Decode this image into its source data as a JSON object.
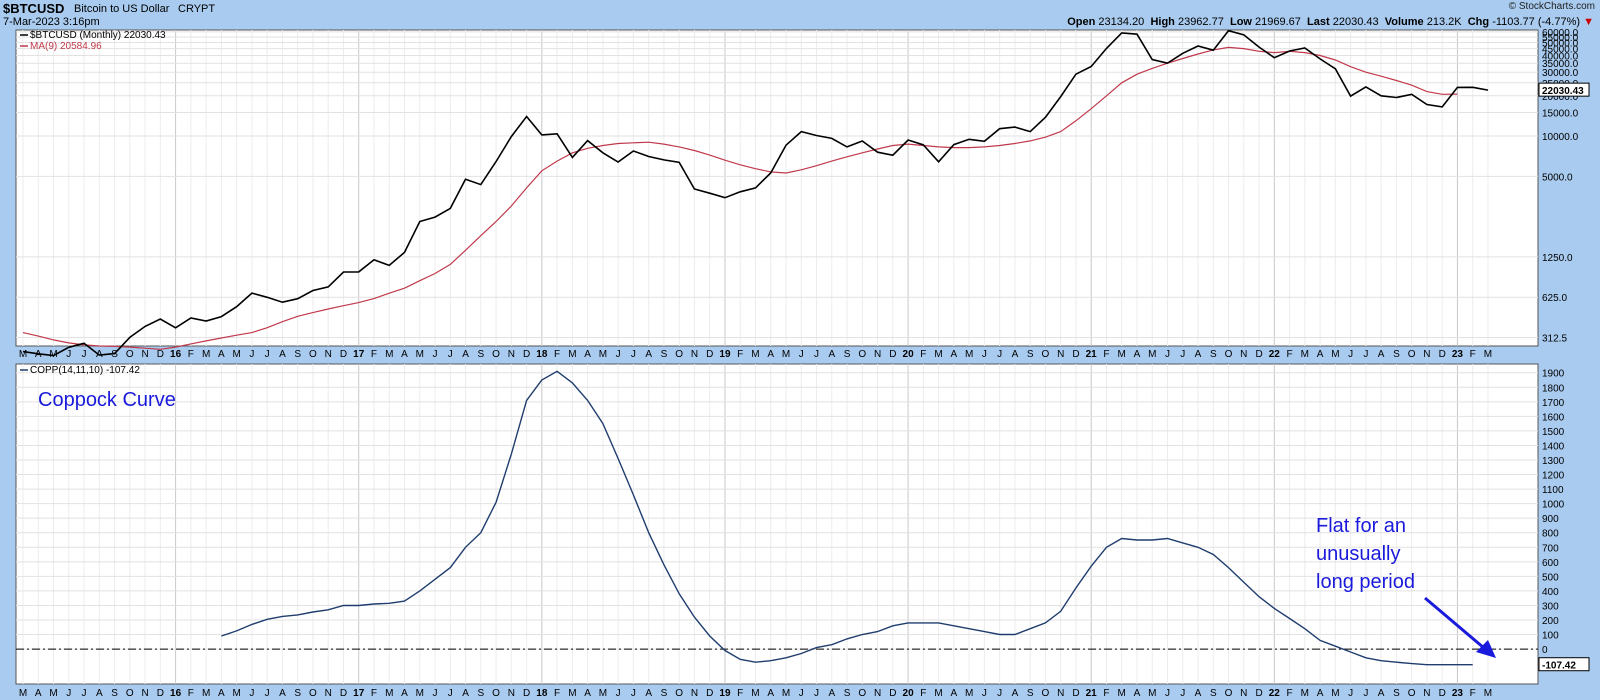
{
  "header": {
    "symbol": "$BTCUSD",
    "name": "Bitcoin to US Dollar",
    "exchange": "CRYPT",
    "date": "7-Mar-2023 3:16pm",
    "credit": "© StockCharts.com",
    "open_label": "Open",
    "open": "23134.20",
    "high_label": "High",
    "high": "23962.77",
    "low_label": "Low",
    "low": "21969.67",
    "last_label": "Last",
    "last": "22030.43",
    "volume_label": "Volume",
    "volume": "213.2K",
    "chg_label": "Chg",
    "chg": "-1103.77 (-4.77%)",
    "chg_arrow": "▼"
  },
  "colors": {
    "background": "#a9cbef",
    "plot": "#ffffff",
    "price_line": "#000000",
    "ma_line": "#c0394b",
    "coppock_line": "#1f3d6e",
    "annotation": "#1a1adc"
  },
  "chart_data": [
    {
      "type": "line",
      "scale": "log",
      "legend": [
        {
          "text": "$BTCUSD (Monthly) 22030.43",
          "color": "#000000"
        },
        {
          "text": "MA(9) 20584.96",
          "color": "#c0394b"
        }
      ],
      "y_ticks": [
        "60000.0",
        "55000.0",
        "50000.0",
        "45000.0",
        "40000.0",
        "35000.0",
        "30000.0",
        "25000.0",
        "20000.0",
        "15000.0",
        "10000.0",
        "5000.0",
        "1250.0",
        "625.0",
        "312.5"
      ],
      "ylim": [
        270,
        62000
      ],
      "last_label": "22030.43",
      "x_months": [
        "M",
        "A",
        "M",
        "J",
        "J",
        "A",
        "S",
        "O",
        "N",
        "D",
        "16",
        "F",
        "M",
        "A",
        "M",
        "J",
        "J",
        "A",
        "S",
        "O",
        "N",
        "D",
        "17",
        "F",
        "M",
        "A",
        "M",
        "J",
        "J",
        "A",
        "S",
        "O",
        "N",
        "D",
        "18",
        "F",
        "M",
        "A",
        "M",
        "J",
        "J",
        "A",
        "S",
        "O",
        "N",
        "D",
        "19",
        "F",
        "M",
        "A",
        "M",
        "J",
        "J",
        "A",
        "S",
        "O",
        "N",
        "D",
        "20",
        "F",
        "M",
        "A",
        "M",
        "J",
        "J",
        "A",
        "S",
        "O",
        "N",
        "D",
        "21",
        "F",
        "M",
        "A",
        "M",
        "J",
        "J",
        "A",
        "S",
        "O",
        "N",
        "D",
        "22",
        "F",
        "M",
        "A",
        "M",
        "J",
        "J",
        "A",
        "S",
        "O",
        "N",
        "D",
        "23",
        "F",
        "M"
      ],
      "series": [
        {
          "name": "$BTCUSD (Monthly)",
          "values": [
            245,
            236,
            229,
            264,
            283,
            231,
            237,
            313,
            378,
            430,
            369,
            437,
            415,
            448,
            531,
            671,
            624,
            574,
            609,
            701,
            746,
            964,
            966,
            1190,
            1080,
            1350,
            2300,
            2480,
            2880,
            4760,
            4340,
            6460,
            9900,
            14000,
            10200,
            10400,
            6930,
            9250,
            7500,
            6400,
            7730,
            7030,
            6630,
            6370,
            4020,
            3740,
            3460,
            3830,
            4100,
            5300,
            8550,
            10800,
            10100,
            9600,
            8300,
            9190,
            7570,
            7190,
            9350,
            8600,
            6420,
            8630,
            9460,
            9140,
            11350,
            11660,
            10790,
            13800,
            19700,
            29000,
            33100,
            45200,
            58900,
            57700,
            37300,
            35000,
            41500,
            47100,
            43800,
            61300,
            57000,
            46200,
            38500,
            43200,
            45500,
            37700,
            31800,
            19900,
            23300,
            20000,
            19400,
            20500,
            17200,
            16500,
            23100,
            23140,
            22030
          ]
        },
        {
          "name": "MA(9)",
          "values": [
            340,
            320,
            300,
            285,
            275,
            270,
            268,
            265,
            260,
            255,
            265,
            280,
            295,
            310,
            325,
            340,
            370,
            410,
            450,
            480,
            510,
            540,
            570,
            610,
            670,
            730,
            830,
            940,
            1100,
            1400,
            1800,
            2300,
            3000,
            4100,
            5500,
            6500,
            7500,
            8100,
            8500,
            8800,
            8900,
            9000,
            8700,
            8300,
            7800,
            7200,
            6600,
            6100,
            5700,
            5400,
            5300,
            5600,
            6000,
            6500,
            7000,
            7500,
            8000,
            8500,
            8700,
            8500,
            8300,
            8200,
            8200,
            8300,
            8500,
            8800,
            9200,
            9800,
            10800,
            13000,
            16000,
            20000,
            25000,
            29000,
            32000,
            35000,
            38000,
            41000,
            44000,
            46000,
            45000,
            43000,
            42000,
            43000,
            42000,
            40000,
            37000,
            33000,
            30000,
            28000,
            26000,
            24000,
            21500,
            20500,
            20585
          ]
        }
      ]
    },
    {
      "type": "line",
      "title": "Coppock Curve",
      "legend": [
        {
          "text": "COPP(14,11,10) -107.42",
          "color": "#1f3d6e"
        }
      ],
      "y_ticks": [
        1900,
        1800,
        1700,
        1600,
        1500,
        1400,
        1300,
        1200,
        1100,
        1000,
        900,
        800,
        700,
        600,
        500,
        400,
        300,
        200,
        100,
        0
      ],
      "ylim": [
        -240,
        1960
      ],
      "last_label": "-107.42",
      "annotation": "Flat for an unusually long period",
      "series": [
        {
          "name": "COPP(14,11,10)",
          "start_index": 13,
          "values": [
            90,
            125,
            170,
            205,
            225,
            235,
            255,
            270,
            300,
            300,
            310,
            315,
            330,
            400,
            480,
            560,
            700,
            800,
            1010,
            1340,
            1710,
            1850,
            1910,
            1830,
            1710,
            1550,
            1310,
            1060,
            800,
            580,
            380,
            220,
            90,
            -10,
            -70,
            -90,
            -80,
            -60,
            -30,
            10,
            30,
            70,
            100,
            120,
            160,
            180,
            180,
            180,
            160,
            140,
            120,
            100,
            100,
            140,
            180,
            260,
            420,
            570,
            700,
            760,
            750,
            750,
            760,
            730,
            700,
            650,
            560,
            460,
            360,
            280,
            210,
            140,
            60,
            20,
            -20,
            -60,
            -80,
            -90,
            -100,
            -107,
            -107,
            -107,
            -107.42
          ]
        }
      ]
    }
  ]
}
